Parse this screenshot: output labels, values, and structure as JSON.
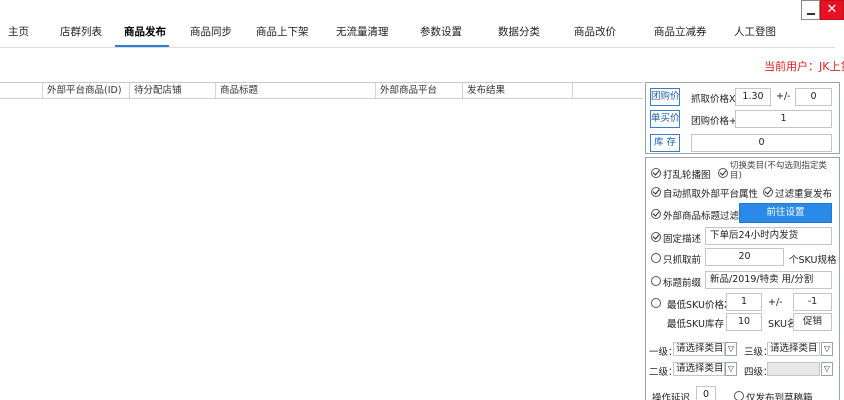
{
  "tabs": [
    {
      "label": "主页"
    },
    {
      "label": "店群列表"
    },
    {
      "label": "商品发布",
      "active": true
    },
    {
      "label": "商品同步"
    },
    {
      "label": "商品上下架"
    },
    {
      "label": "无流量清理"
    },
    {
      "label": "参数设置"
    },
    {
      "label": "数据分类"
    },
    {
      "label": "商品改价"
    },
    {
      "label": "商品立减券"
    },
    {
      "label": "人工登图"
    }
  ],
  "window": {
    "minimize_glyph": "—",
    "close_glyph": "✕"
  },
  "current_user": "当前用户：JK上贷",
  "table": {
    "columns": [
      "外部平台商品(ID)",
      "待分配店铺",
      "商品标题",
      "外部商品平台",
      "发布结果"
    ],
    "rows": []
  },
  "pricing": {
    "group_price_button": "团购价",
    "grab_price_label": "抓取价格X",
    "grab_price_value": "1.30",
    "plus_minus_label": "+/-",
    "plus_minus_value": "0",
    "single_price_button": "单买价",
    "group_price_plus_label": "团购价格+",
    "group_price_plus_value": "1",
    "stock_button": "库 存",
    "stock_value": "0"
  },
  "options": {
    "shuffle_images": "打乱轮播图",
    "category_hint": "切换类目(不勾选则指定类目)",
    "auto_grab_attrs": "自动抓取外部平台属性",
    "filter_duplicates": "过滤重复发布",
    "external_title_filter": "外部商品标题过滤",
    "goto_settings_button": "前往设置",
    "fixed_desc_label": "固定描述",
    "fixed_desc_value": "下单后24小时内发货",
    "only_grab_label": "只抓取前",
    "only_grab_value": "20",
    "sku_spec_label": "个SKU规格",
    "title_prefix_label": "标题前缀",
    "title_prefix_value": "新品/2019/特卖 用/分割",
    "min_sku_price_label": "最低SKU价格X",
    "min_sku_price_value": "1",
    "min_sku_plus_minus": "+/-",
    "min_sku_plus_minus_value": "-1",
    "min_sku_stock_label": "最低SKU库存",
    "min_sku_stock_value": "10",
    "sku_name_label": "SKU名",
    "promo_button": "促销"
  },
  "categories": {
    "level1_label": "一级：",
    "level1_value": "请选择类目",
    "level3_label": "三级：",
    "level3_value": "请选择类目",
    "level2_label": "二级：",
    "level2_value": "请选择类目",
    "level4_label": "四级：",
    "level4_value": ""
  },
  "footer": {
    "delay_label": "操作延迟",
    "delay_value": "0",
    "draft_only_label": "仅发布到草稿箱"
  },
  "colors": {
    "accent": "#2a8ae8",
    "user_text": "#e02020",
    "close_button": "#e81123"
  }
}
